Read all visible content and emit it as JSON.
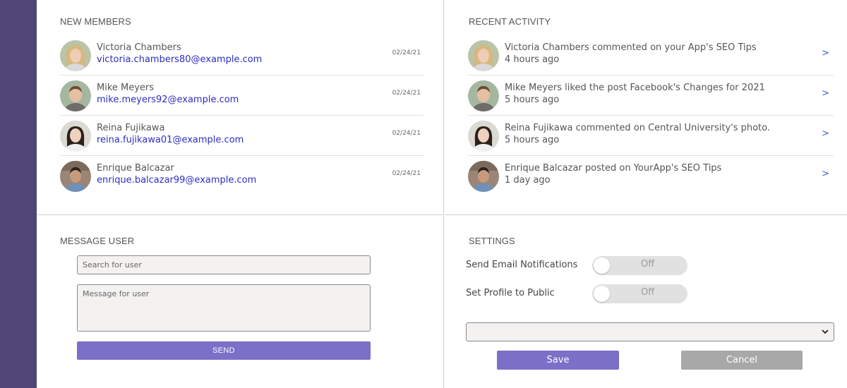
{
  "members": {
    "title": "NEW MEMBERS",
    "items": [
      {
        "name": "Victoria Chambers",
        "email": "victoria.chambers80@example.com",
        "date": "02/24/21"
      },
      {
        "name": "Mike Meyers",
        "email": "mike.meyers92@example.com",
        "date": "02/24/21"
      },
      {
        "name": "Reina Fujikawa",
        "email": "reina.fujikawa01@example.com",
        "date": "02/24/21"
      },
      {
        "name": "Enrique Balcazar",
        "email": "enrique.balcazar99@example.com",
        "date": "02/24/21"
      }
    ]
  },
  "activity": {
    "title": "RECENT ACTIVITY",
    "chevron": ">",
    "items": [
      {
        "text": "Victoria Chambers commented on your App's SEO Tips",
        "time": "4 hours ago"
      },
      {
        "text": "Mike Meyers liked the post Facebook's Changes for 2021",
        "time": "5 hours ago"
      },
      {
        "text": "Reina Fujikawa commented on Central University's photo.",
        "time": "5 hours ago"
      },
      {
        "text": "Enrique Balcazar posted on YourApp's SEO Tips",
        "time": "1 day ago"
      }
    ]
  },
  "message": {
    "title": "MESSAGE USER",
    "search_placeholder": "Search for user",
    "message_placeholder": "Message for user",
    "send_label": "SEND"
  },
  "settings": {
    "title": "SETTINGS",
    "email_label": "Send Email Notifications",
    "email_state": "Off",
    "public_label": "Set Profile to Public",
    "public_state": "Off",
    "save_label": "Save",
    "cancel_label": "Cancel"
  },
  "colors": {
    "sidebar": "#4f4577",
    "accent": "#7b6fc7",
    "link": "#2d2dc2",
    "chevron": "#3a5cc9",
    "cancel": "#a8a8a8"
  }
}
